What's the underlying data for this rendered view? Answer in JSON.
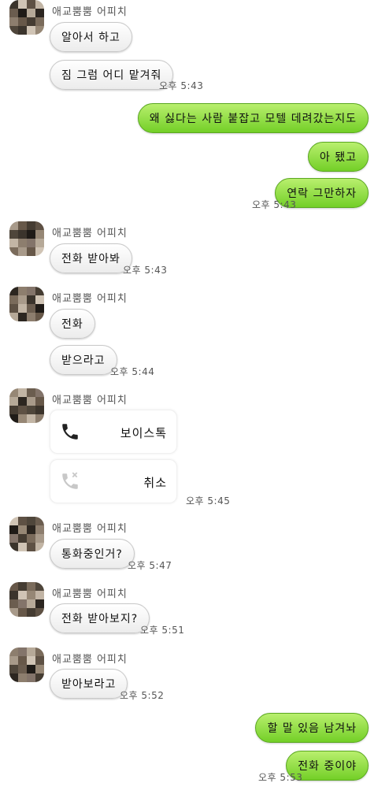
{
  "contact": {
    "name": "애교뿜뿜 어피치"
  },
  "messages": {
    "m1": "알아서 하고",
    "m2": "짐 그럼 어디 맡겨줘",
    "t1": "오후 5:43",
    "m3": "왜 싫다는 사람 붙잡고 모텔 데려갔는지도",
    "m4": "아 됐고",
    "m5": "연락 그만하자",
    "t2": "오후 5:43",
    "m6": "전화 받아봐",
    "t3": "오후 5:43",
    "m7": "전화",
    "m8": "받으라고",
    "t4": "오후 5:44",
    "call1": "보이스톡",
    "call2": "취소",
    "t5": "오후 5:45",
    "m9": "통화중인거?",
    "t6": "오후 5:47",
    "m10": "전화 받아보지?",
    "t7": "오후 5:51",
    "m11": "받아보라고",
    "t8": "오후 5:52",
    "m12": "할 말 있음 남겨놔",
    "m13": "전화 중이야",
    "t9": "오후 5:53"
  },
  "colors": {
    "outgoing": "#8ee04a",
    "incoming": "#f2f2f2",
    "call_icon": "#222222",
    "call_cancel_icon": "#c8c8c8"
  },
  "icons": {
    "voice_call": "phone-icon",
    "cancelled_call": "phone-cancel-icon"
  }
}
